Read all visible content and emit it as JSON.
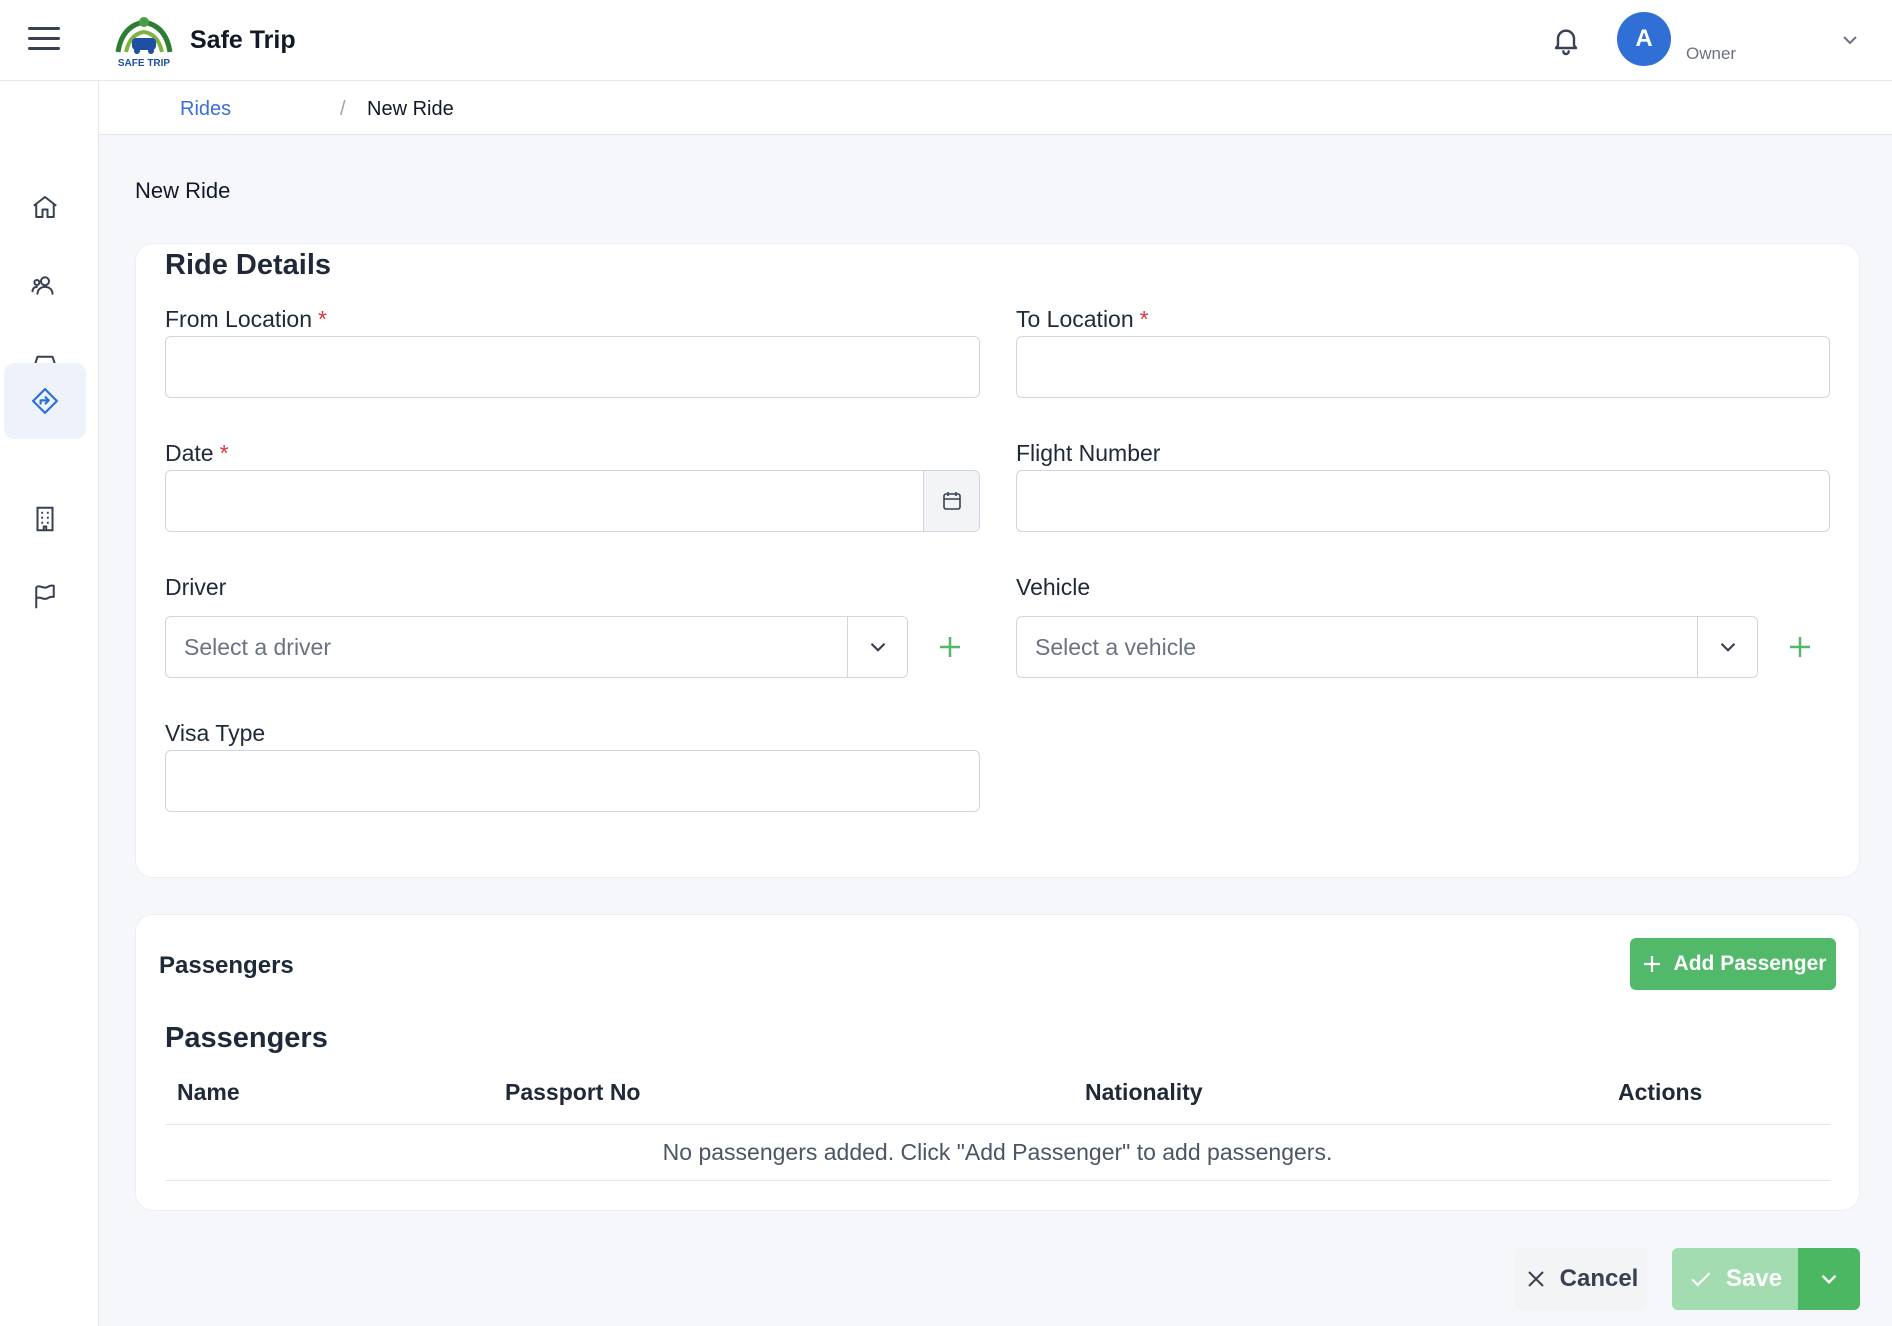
{
  "header": {
    "brand": "Safe Trip",
    "logo_text": "SAFE TRIP",
    "avatar_initial": "A",
    "user_role": "Owner"
  },
  "sidebar": {
    "items": [
      {
        "icon": "home-icon"
      },
      {
        "icon": "users-icon"
      },
      {
        "icon": "car-icon"
      },
      {
        "icon": "route-icon",
        "active": true
      },
      {
        "icon": "building-icon"
      },
      {
        "icon": "flag-icon"
      }
    ]
  },
  "breadcrumb": {
    "parent": "Rides",
    "separator": "/",
    "current": "New Ride"
  },
  "page": {
    "title": "New Ride"
  },
  "ride_details": {
    "title": "Ride Details",
    "from_label": "From Location",
    "to_label": "To Location",
    "date_label": "Date",
    "flight_label": "Flight Number",
    "driver_label": "Driver",
    "driver_placeholder": "Select a driver",
    "vehicle_label": "Vehicle",
    "vehicle_placeholder": "Select a vehicle",
    "visa_label": "Visa Type",
    "required_mark": "*"
  },
  "passengers": {
    "header": "Passengers",
    "add_button": "Add Passenger",
    "subtitle": "Passengers",
    "columns": [
      "Name",
      "Passport No",
      "Nationality",
      "Actions"
    ],
    "empty_message": "No passengers added. Click \"Add Passenger\" to add passengers."
  },
  "actions": {
    "cancel": "Cancel",
    "save": "Save"
  },
  "colors": {
    "primary_blue": "#2f6fd6",
    "link_blue": "#3b6fd6",
    "success_green": "#52b86a",
    "save_disabled_green": "#a3dcb0",
    "required_red": "#d9363e"
  }
}
